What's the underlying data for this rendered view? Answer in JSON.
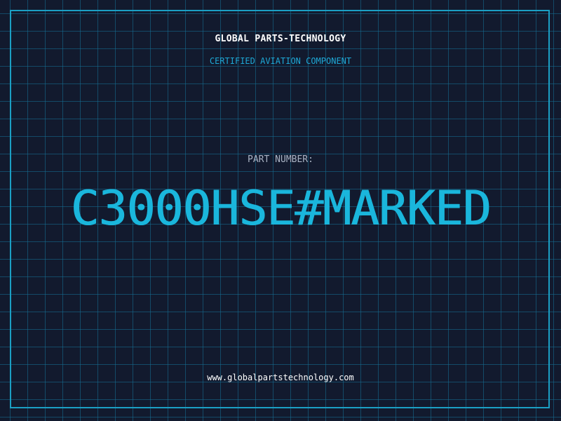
{
  "header": {
    "brand": "GLOBAL PARTS-TECHNOLOGY",
    "subtitle": "CERTIFIED AVIATION COMPONENT"
  },
  "part": {
    "label": "PART NUMBER:",
    "number": "C3000HSE#MARKED"
  },
  "footer": {
    "website": "www.globalpartstechnology.com"
  },
  "colors": {
    "background": "#121a2e",
    "grid": "#167096",
    "accent": "#1ab6dc",
    "border": "#1b9fc4",
    "text": "#ffffff",
    "muted": "#a9b3c4"
  }
}
